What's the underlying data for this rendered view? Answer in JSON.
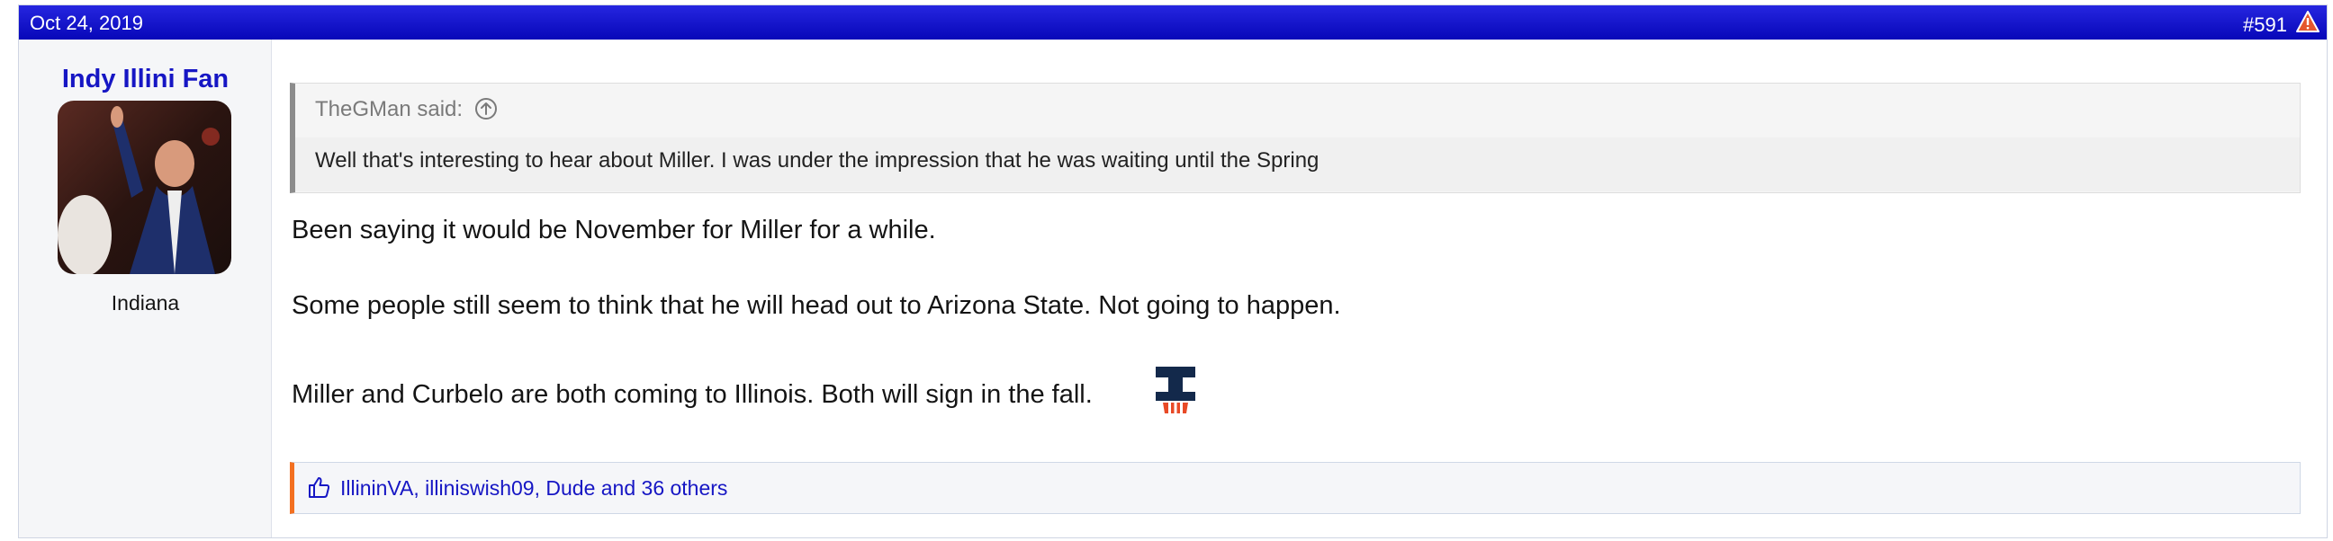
{
  "post": {
    "date": "Oct 24, 2019",
    "number": "#591"
  },
  "user": {
    "name": "Indy Illini Fan",
    "location": "Indiana"
  },
  "quote": {
    "author_line": "TheGMan said:",
    "text": "Well that's interesting to hear about Miller. I was under the impression that he was waiting until the Spring"
  },
  "body": {
    "paragraphs": [
      "Been saying it would be November for Miller for a while.",
      "Some people still seem to think that he will head out to Arizona State. Not going to happen.",
      "Miller and Curbelo are both coming to Illinois. Both will sign in the fall."
    ]
  },
  "reactions": {
    "text": "IllininVA, illiniswish09, Dude and 36 others"
  },
  "icons": {
    "report": "warning-triangle-icon",
    "quote_jump": "arrow-up-circle-icon",
    "like": "thumbs-up-icon",
    "emoji": "illini-block-i-icon"
  },
  "colors": {
    "header": "#0707b8",
    "username": "#1616c4",
    "reaction_accent": "#f37021",
    "link": "#1616c4"
  }
}
